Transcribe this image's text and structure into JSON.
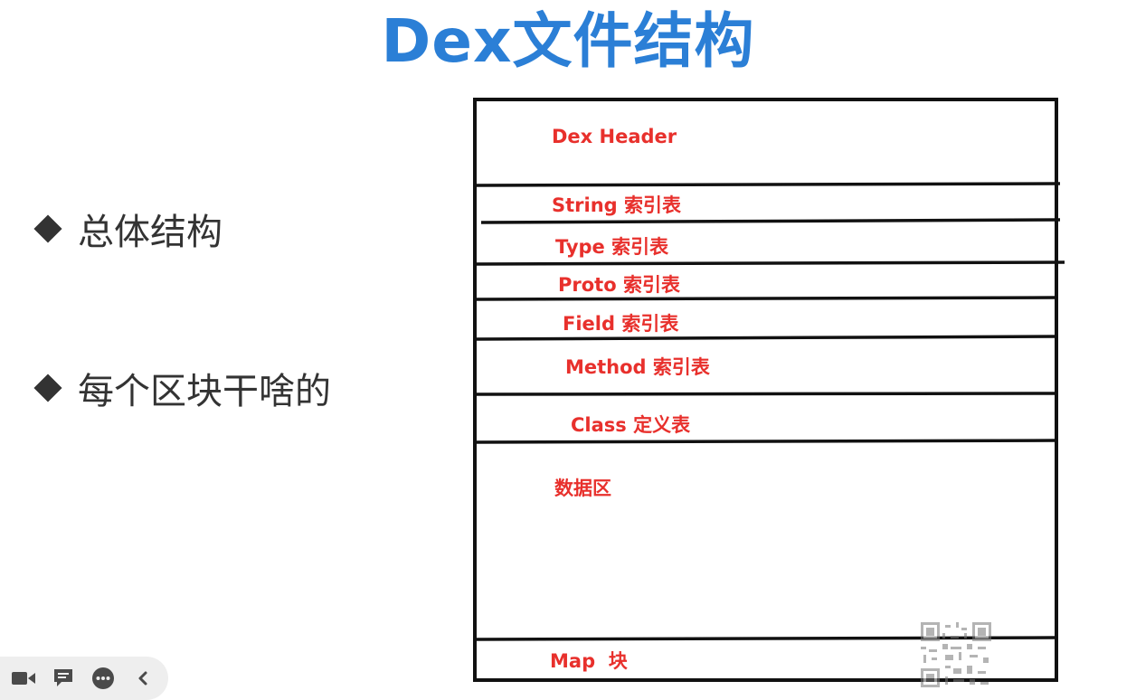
{
  "title": "Dex文件结构",
  "bullets": [
    {
      "text": "总体结构"
    },
    {
      "text": "每个区块干啥的"
    }
  ],
  "diagram": {
    "segments": [
      {
        "label": "Dex Header"
      },
      {
        "label": "String 索引表"
      },
      {
        "label": "Type 索引表"
      },
      {
        "label": "Proto 索引表"
      },
      {
        "label": "Field 索引表"
      },
      {
        "label": "Method 索引表"
      },
      {
        "label": "Class 定义表"
      },
      {
        "label": "数据区"
      },
      {
        "label": "Map  块"
      }
    ],
    "label_color": "#e8302c",
    "line_color": "#111111"
  },
  "toolbar": {
    "buttons": [
      {
        "icon": "video-camera-icon"
      },
      {
        "icon": "chat-bubble-icon"
      },
      {
        "icon": "more-options-icon"
      },
      {
        "icon": "chevron-left-icon"
      }
    ]
  },
  "accent_color": "#2b7fd6"
}
